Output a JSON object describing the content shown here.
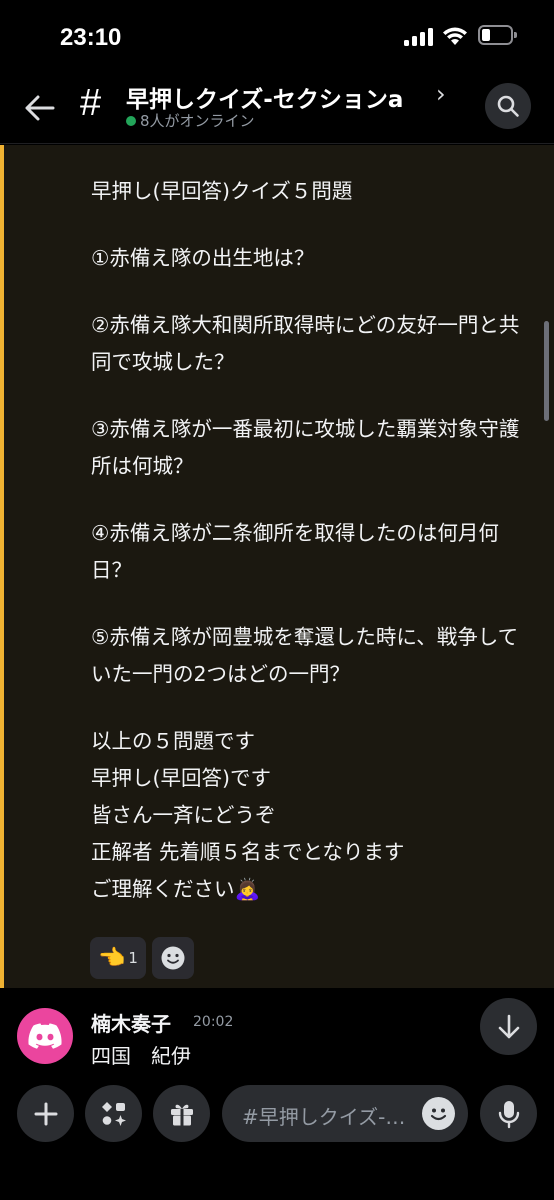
{
  "status_bar": {
    "time": "23:10"
  },
  "header": {
    "hash_symbol": "#",
    "channel_name": "早押しクイズ-セクションa",
    "chevron": "›",
    "online_text": "8人がオンライン",
    "online_color": "#23a55a"
  },
  "message": {
    "paragraphs": [
      "早押し(早回答)クイズ５問題",
      "①赤備え隊の出生地は？",
      "②赤備え隊大和関所取得時にどの友好一門と共同で攻城した？",
      "③赤備え隊が一番最初に攻城した覇業対象守護所は何城？",
      "④赤備え隊が二条御所を取得したのは何月何日？",
      "⑤赤備え隊が岡豊城を奪還した時に、戦争していた一門の2つはどの一門？"
    ],
    "closing_lines": [
      "以上の５問題です",
      "早押し(早回答)です",
      "皆さん一斉にどうぞ",
      "正解者 先着順５名までとなります",
      "ご理解ください🙇‍♀️"
    ],
    "reactions": [
      {
        "emoji": "👈",
        "count": "1"
      }
    ],
    "mention_highlight_color": "#f0b232"
  },
  "second_message": {
    "author": "楠木奏子",
    "timestamp": "20:02",
    "text": "四国　紀伊",
    "avatar_color": "#eb459e"
  },
  "composer": {
    "placeholder": "#早押しクイズ-セクションaにメッセージを送信"
  },
  "icons": {
    "back": "arrow-left-icon",
    "search": "search-icon",
    "jump": "arrow-down-icon",
    "plus": "plus-icon",
    "apps": "apps-icon",
    "gift": "gift-icon",
    "emoji": "smiley-icon",
    "mic": "microphone-icon"
  }
}
